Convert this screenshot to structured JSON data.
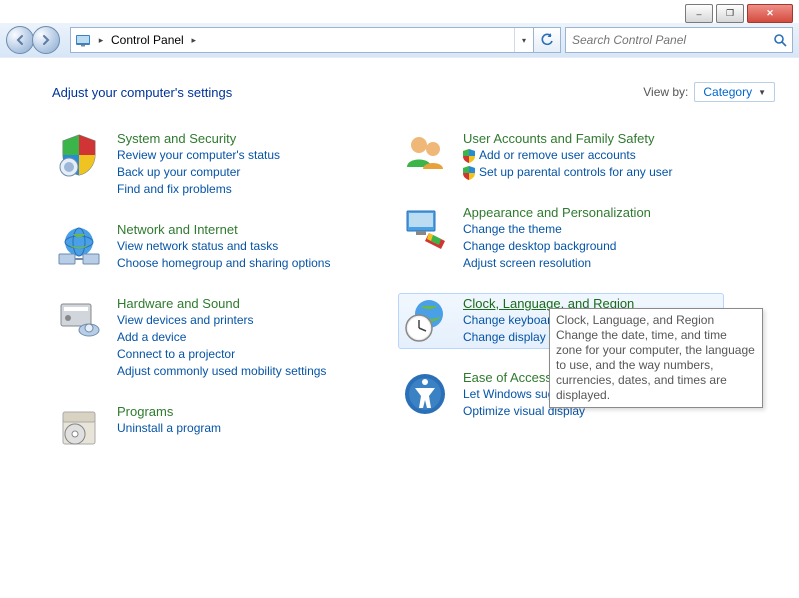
{
  "window_buttons": {
    "minimize": "–",
    "maximize": "❐",
    "close": "✕"
  },
  "breadcrumb": {
    "root": "Control Panel"
  },
  "search": {
    "placeholder": "Search Control Panel"
  },
  "page_title": "Adjust your computer's settings",
  "viewby": {
    "label": "View by:",
    "value": "Category"
  },
  "left": [
    {
      "title": "System and Security",
      "links": [
        "Review your computer's status",
        "Back up your computer",
        "Find and fix problems"
      ]
    },
    {
      "title": "Network and Internet",
      "links": [
        "View network status and tasks",
        "Choose homegroup and sharing options"
      ]
    },
    {
      "title": "Hardware and Sound",
      "links": [
        "View devices and printers",
        "Add a device",
        "Connect to a projector",
        "Adjust commonly used mobility settings"
      ]
    },
    {
      "title": "Programs",
      "links": [
        "Uninstall a program"
      ]
    }
  ],
  "right": [
    {
      "title": "User Accounts and Family Safety",
      "links": [
        "Add or remove user accounts",
        "Set up parental controls for any user"
      ],
      "shields": [
        0,
        1
      ]
    },
    {
      "title": "Appearance and Personalization",
      "links": [
        "Change the theme",
        "Change desktop background",
        "Adjust screen resolution"
      ]
    },
    {
      "title": "Clock, Language, and Region",
      "links": [
        "Change keyboards or other input methods",
        "Change display language"
      ],
      "hover": true
    },
    {
      "title": "Ease of Access",
      "links": [
        "Let Windows suggest settings",
        "Optimize visual display"
      ]
    }
  ],
  "tooltip": {
    "title": "Clock, Language, and Region",
    "body": "Change the date, time, and time zone for your computer, the language to use, and the way numbers, currencies, dates, and times are displayed."
  }
}
